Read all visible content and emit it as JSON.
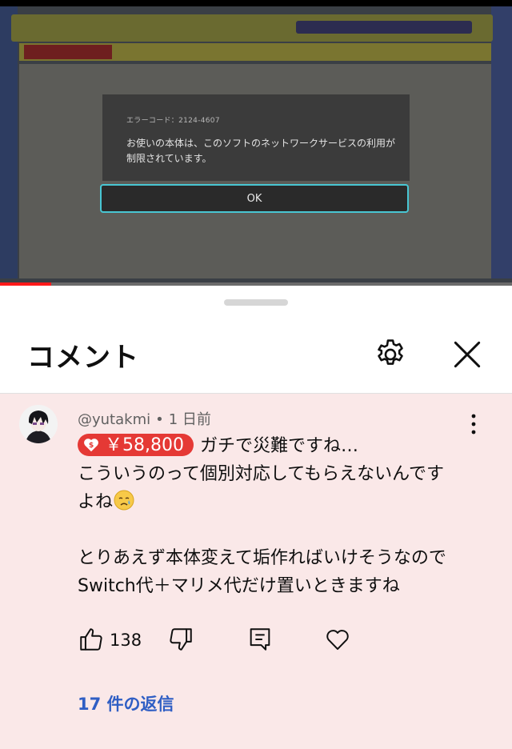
{
  "video": {
    "dialog": {
      "error_code": "エラーコード：2124-4607",
      "message": "お使いの本体は、このソフトのネットワークサービスの利用が制限されています。",
      "ok_label": "OK"
    },
    "progress_fraction": 0.1
  },
  "sheet": {
    "title": "コメント",
    "settings_icon": "gear-icon",
    "close_icon": "close-icon"
  },
  "comment": {
    "author": "@yutakmi",
    "separator": "•",
    "time": "1 日前",
    "super_thanks_amount": "￥58,800",
    "line1": "ガチで災難ですね…",
    "line2": "こういうのって個別対応してもらえないんです",
    "line3": "よね",
    "line4": "とりあえず本体変えて垢作ればいけそうなので",
    "line5": "Switch代＋マリメ代だけ置いときますね",
    "likes": "138",
    "replies_label": "17 件の返信",
    "colors": {
      "background": "#fae8e8",
      "chip": "#e53935",
      "replies": "#2f5ec4"
    }
  }
}
